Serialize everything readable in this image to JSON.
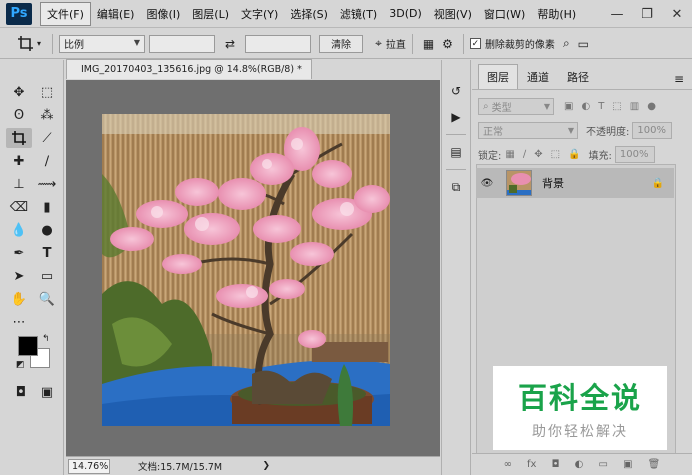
{
  "app": {
    "logo": "Ps"
  },
  "menu": [
    "文件(F)",
    "编辑(E)",
    "图像(I)",
    "图层(L)",
    "文字(Y)",
    "选择(S)",
    "滤镜(T)",
    "3D(D)",
    "视图(V)",
    "窗口(W)",
    "帮助(H)"
  ],
  "window_controls": {
    "minimize": "—",
    "restore": "❐",
    "close": "✕"
  },
  "options": {
    "ratio_label": "比例",
    "clear_label": "清除",
    "straighten_label": "拉直",
    "delete_cropped_label": "删除裁剪的像素",
    "delete_cropped_checked": true,
    "swap_icon": "⇄",
    "straighten_icon": "⌖",
    "grid_icon": "▦",
    "gear_icon": "⚙",
    "search_icon": "⌕",
    "workspace_icon": "▭"
  },
  "document": {
    "tab_title": "IMG_20170403_135616.jpg @ 14.8%(RGB/8) *",
    "close": "×",
    "zoom": "14.76%",
    "doc_info": "文档:15.7M/15.7M",
    "status_arrow": "❯"
  },
  "layers_panel": {
    "tabs": [
      "图层",
      "通道",
      "路径"
    ],
    "active_tab": 0,
    "filter_placeholder": "类型",
    "blend_mode": "正常",
    "opacity_label": "不透明度:",
    "opacity_value": "100%",
    "lock_label": "锁定:",
    "fill_label": "填充:",
    "fill_value": "100%",
    "layers": [
      {
        "name": "背景",
        "visible": true,
        "locked": true
      }
    ],
    "footer_icons": [
      "∞",
      "fx",
      "◘",
      "◐",
      "▭",
      "▣",
      "🗑"
    ]
  },
  "watermark": {
    "main": "百科全说",
    "sub": "助你轻松解决",
    "color": "#1aa34a"
  }
}
